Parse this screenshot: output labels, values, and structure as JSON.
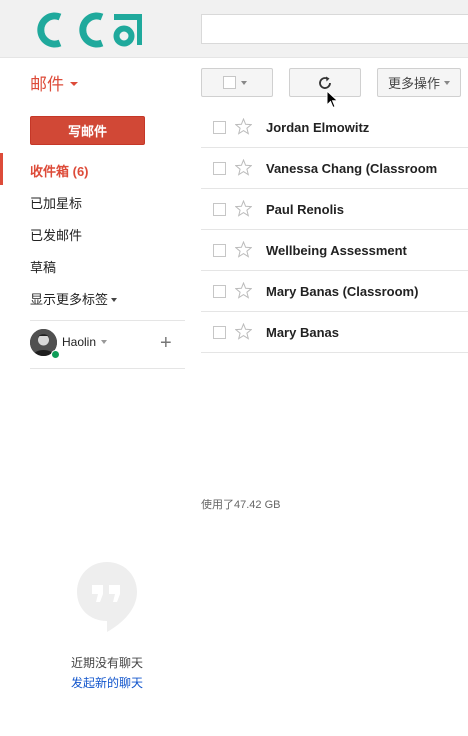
{
  "search": {
    "placeholder": ""
  },
  "toolbar": {
    "mail_label": "邮件",
    "more_label": "更多操作"
  },
  "sidebar": {
    "compose_label": "写邮件",
    "items": [
      {
        "label": "收件箱 (6)"
      },
      {
        "label": "已加星标"
      },
      {
        "label": "已发邮件"
      },
      {
        "label": "草稿"
      },
      {
        "label": "显示更多标签"
      }
    ]
  },
  "chat": {
    "user_name": "Haolin",
    "add_label": "+",
    "no_chat_text": "近期没有聊天",
    "start_chat_link": "发起新的聊天"
  },
  "messages": [
    {
      "sender": "Jordan Elmowitz"
    },
    {
      "sender": "Vanessa Chang (Classroom"
    },
    {
      "sender": "Paul Renolis"
    },
    {
      "sender": "Wellbeing Assessment"
    },
    {
      "sender": "Mary Banas (Classroom)"
    },
    {
      "sender": "Mary Banas"
    }
  ],
  "storage": {
    "usage_text": "使用了47.42 GB"
  },
  "colors": {
    "accent_red": "#dd4b39",
    "compose_red": "#d14836",
    "logo_teal": "#1fa99c",
    "link_blue": "#1155cc",
    "presence_green": "#0f9d58"
  }
}
